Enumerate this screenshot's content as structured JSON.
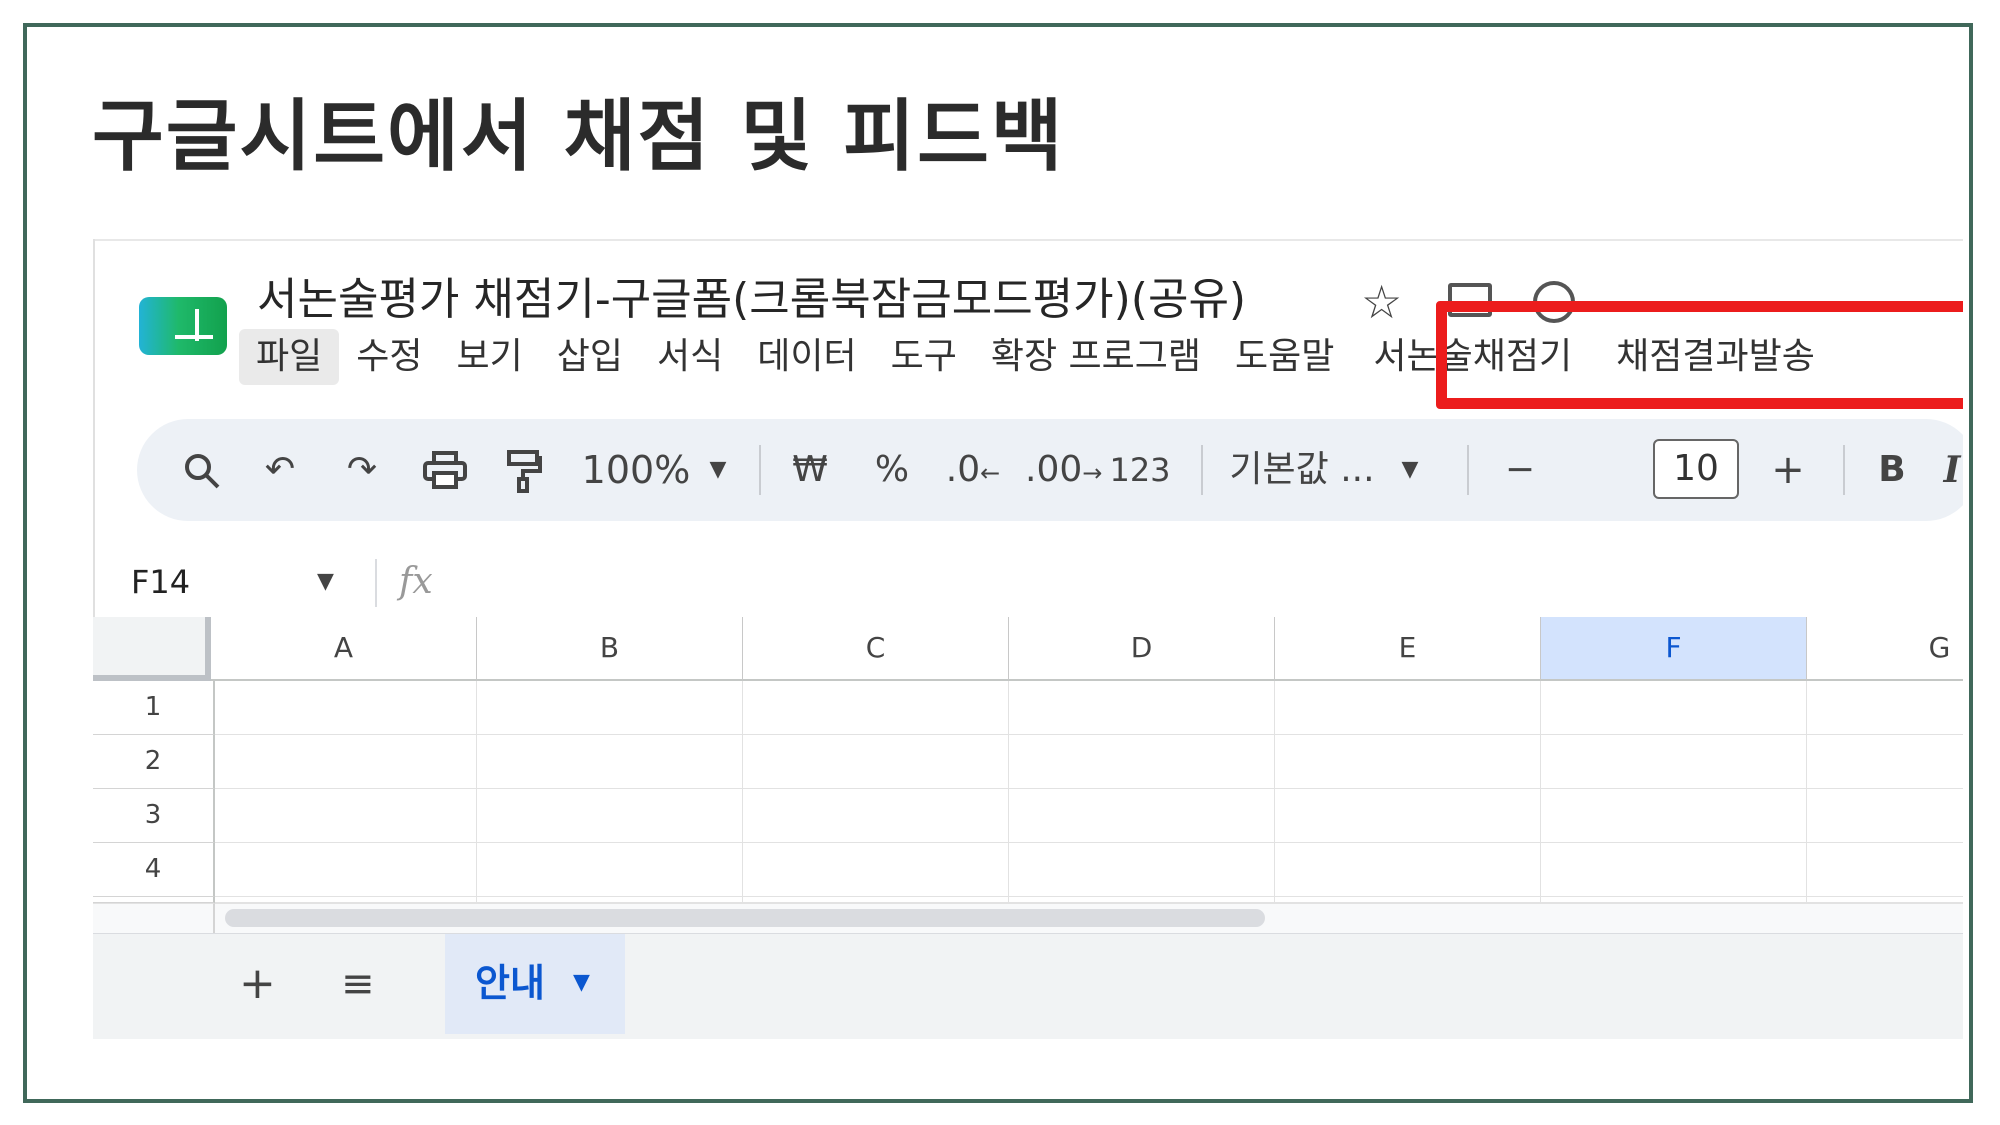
{
  "slide_title": "구글시트에서 채점 및 피드백",
  "doc_title": "서논술평가 채점기-구글폼(크롬북잠금모드평가)(공유)",
  "menu": [
    "파일",
    "수정",
    "보기",
    "삽입",
    "서식",
    "데이터",
    "도구",
    "확장 프로그램",
    "도움말",
    "서논술채점기",
    "채점결과발송"
  ],
  "highlight_color": "#ec1c1c",
  "toolbar": {
    "zoom": "100%",
    "currency": "₩",
    "percent": "%",
    "decrease_decimal": ".0",
    "increase_decimal": ".00",
    "number_format": "123",
    "font": "기본값 ...",
    "minus": "−",
    "font_size": "10",
    "plus": "+",
    "bold": "B",
    "italic": "I"
  },
  "formula_bar": {
    "name_box": "F14",
    "fx": "fx"
  },
  "grid": {
    "columns": [
      "A",
      "B",
      "C",
      "D",
      "E",
      "F",
      "G"
    ],
    "selected_column": "F",
    "rows": [
      "1",
      "2",
      "3",
      "4"
    ]
  },
  "sheet_tabs": {
    "add": "+",
    "list": "≡",
    "active": "안내"
  }
}
